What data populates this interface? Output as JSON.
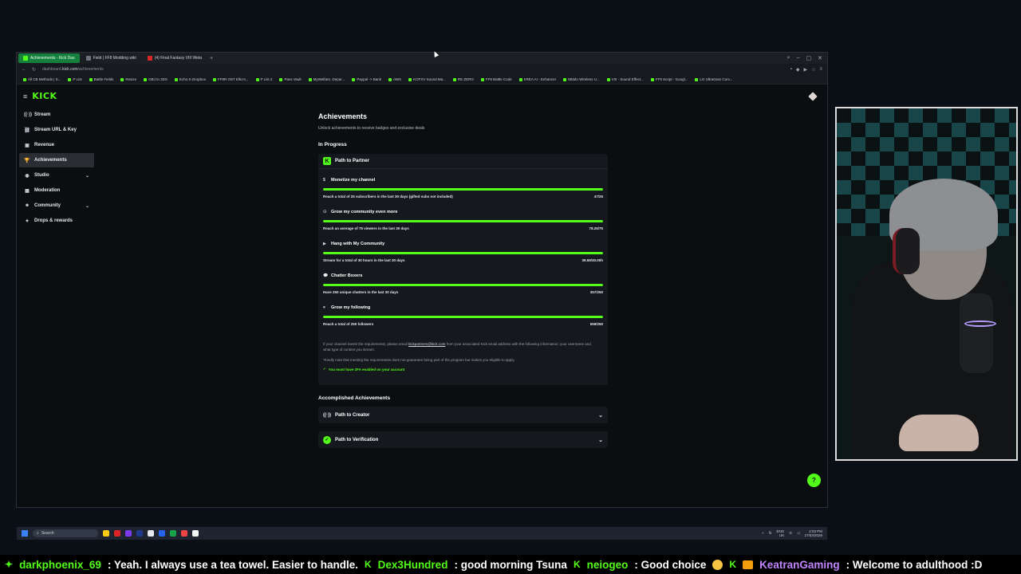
{
  "browser": {
    "tabs": [
      {
        "label": "Achievements - Kick Das"
      },
      {
        "label": "Field | FF8 Modding wiki"
      },
      {
        "label": "(4) Final Fantasy VIII Weta"
      }
    ],
    "url_prefix": "dashboard.",
    "url_domain": "kick.com",
    "url_path": "/achievements",
    "bookmarks": [
      "All CB Methods | S...",
      "P List",
      "Battle Fields",
      "Resize",
      "OBJ to 3DS",
      "Echo-S Dropbox",
      "FF8R OST Elko's...",
      "P List 2",
      "Pass Vault",
      "MyWelfare, Depar...",
      "Paypal -> Bank",
      "AWS",
      "KOFXV Sound Ma...",
      "RE ZERO",
      "FF8 Battle Code",
      "KREA AI - Enhancer",
      "8Bitdo Wireless U...",
      "VIII - Sound Effect...",
      "FF9 Script - Googl...",
      "LG UltraGear Curv..."
    ]
  },
  "sidebar": {
    "logo": "KICK",
    "items": [
      {
        "label": "Stream",
        "icon": "broadcast-icon",
        "glyph": "((·))"
      },
      {
        "label": "Stream URL & Key",
        "icon": "link-icon",
        "glyph": "⛓"
      },
      {
        "label": "Revenue",
        "icon": "wallet-icon",
        "glyph": "▣"
      },
      {
        "label": "Achievements",
        "icon": "trophy-icon",
        "glyph": "🏆"
      },
      {
        "label": "Studio",
        "icon": "studio-icon",
        "glyph": "◉"
      },
      {
        "label": "Moderation",
        "icon": "shield-icon",
        "glyph": "▦"
      },
      {
        "label": "Community",
        "icon": "people-icon",
        "glyph": "☻"
      },
      {
        "label": "Drops & rewards",
        "icon": "gift-icon",
        "glyph": "✦"
      }
    ]
  },
  "main": {
    "title": "Achievements",
    "subtitle": "Unlock achievements to receive badges and exclusive deals",
    "in_progress_heading": "In Progress",
    "card_title": "Path to Partner",
    "card_badge": "K",
    "goals": [
      {
        "title": "Monetize my channel",
        "icon": "dollar-icon",
        "glyph": "$",
        "desc": "Reach a total of 25 subscribers in the last 30 days (gifted subs not included)",
        "value": "47/25",
        "progress": 1.0
      },
      {
        "title": "Grow my community even more",
        "icon": "group-icon",
        "glyph": "⚇",
        "desc": "Reach an average of 75 viewers in the last 30 days",
        "value": "78.25/75",
        "progress": 1.0
      },
      {
        "title": "Hang with My Community",
        "icon": "video-icon",
        "glyph": "▶",
        "desc": "Stream for a total of 30 hours in the last 30 days",
        "value": "39.59/30.00h",
        "progress": 1.0
      },
      {
        "title": "Chatter Boxers",
        "icon": "chat-icon",
        "glyph": "💬",
        "desc": "Have 250 unique chatters in the last 30 days",
        "value": "357/250",
        "progress": 1.0
      },
      {
        "title": "Grow my following",
        "icon": "heart-icon",
        "glyph": "♥",
        "desc": "Reach a total of 250 followers",
        "value": "559/250",
        "progress": 1.0
      }
    ],
    "note_pre": "If your channel meets the requirements, please email ",
    "note_email": "kickpartners@kick.com",
    "note_post": " from your associated Kick email address with the following information: your username and what type of content you stream.",
    "note_2": "*Kindly note that meeting the requirements does not guarantee being part of the program but makes you eligible to apply.",
    "twofa_text": "You must have 2FA enabled on your account",
    "accomplished_heading": "Accomplished Achievements",
    "accomplished": [
      {
        "label": "Path to Creator",
        "icon": "broadcast-icon",
        "glyph": "((·))"
      },
      {
        "label": "Path to Verification",
        "icon": "verified-icon",
        "glyph": "✓"
      }
    ]
  },
  "taskbar": {
    "search_placeholder": "Search",
    "lang": "ENG",
    "region": "UK",
    "time": "2:03 PM",
    "date": "27/03/2026"
  },
  "chat": [
    {
      "user": "darkphoenix_69",
      "msg": ": Yeah. I always use a tea towel. Easier to handle."
    },
    {
      "user": "Dex3Hundred",
      "msg": ": good morning Tsuna"
    },
    {
      "user": "neiogeo",
      "msg": ": Good choice"
    },
    {
      "user": "KeatranGaming",
      "msg": ": Welcome to adulthood :D"
    }
  ],
  "colors": {
    "brand": "#53fc18",
    "background": "#0b0e11",
    "card": "#15181c"
  }
}
